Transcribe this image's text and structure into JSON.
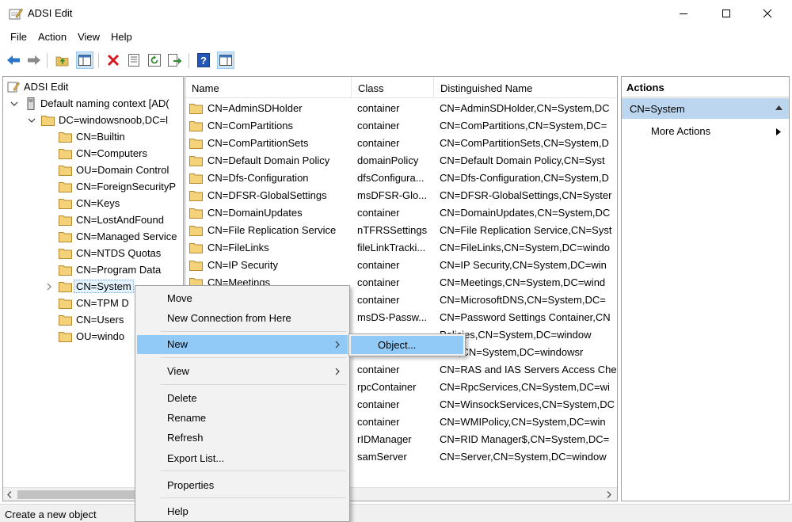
{
  "window": {
    "title": "ADSI Edit"
  },
  "menu": [
    "File",
    "Action",
    "View",
    "Help"
  ],
  "toolbar_icons": [
    "back-arrow-icon",
    "forward-arrow-icon",
    "up-folder-icon",
    "show-hide-tree-icon",
    "delete-icon",
    "properties-icon",
    "refresh-icon",
    "export-list-icon",
    "help-icon",
    "show-hide-action-pane-icon"
  ],
  "tree": {
    "root": "ADSI Edit",
    "context": "Default naming context [AD(",
    "domain": "DC=windowsnoob,DC=l",
    "children": [
      "CN=Builtin",
      "CN=Computers",
      "OU=Domain Control",
      "CN=ForeignSecurityP",
      "CN=Keys",
      "CN=LostAndFound",
      "CN=Managed Service",
      "CN=NTDS Quotas",
      "CN=Program Data",
      "CN=System",
      "CN=TPM D",
      "CN=Users",
      "OU=windo"
    ],
    "selected": "CN=System"
  },
  "list": {
    "columns": [
      "Name",
      "Class",
      "Distinguished Name"
    ],
    "rows": [
      {
        "name": "CN=AdminSDHolder",
        "class": "container",
        "dn": "CN=AdminSDHolder,CN=System,DC"
      },
      {
        "name": "CN=ComPartitions",
        "class": "container",
        "dn": "CN=ComPartitions,CN=System,DC="
      },
      {
        "name": "CN=ComPartitionSets",
        "class": "container",
        "dn": "CN=ComPartitionSets,CN=System,D"
      },
      {
        "name": "CN=Default Domain Policy",
        "class": "domainPolicy",
        "dn": "CN=Default Domain Policy,CN=Syst"
      },
      {
        "name": "CN=Dfs-Configuration",
        "class": "dfsConfigura...",
        "dn": "CN=Dfs-Configuration,CN=System,D"
      },
      {
        "name": "CN=DFSR-GlobalSettings",
        "class": "msDFSR-Glo...",
        "dn": "CN=DFSR-GlobalSettings,CN=Syster"
      },
      {
        "name": "CN=DomainUpdates",
        "class": "container",
        "dn": "CN=DomainUpdates,CN=System,DC"
      },
      {
        "name": "CN=File Replication Service",
        "class": "nTFRSSettings",
        "dn": "CN=File Replication Service,CN=Syst"
      },
      {
        "name": "CN=FileLinks",
        "class": "fileLinkTracki...",
        "dn": "CN=FileLinks,CN=System,DC=windo"
      },
      {
        "name": "CN=IP Security",
        "class": "container",
        "dn": "CN=IP Security,CN=System,DC=win"
      },
      {
        "name": "CN=Meetings",
        "class": "container",
        "dn": "CN=Meetings,CN=System,DC=wind"
      },
      {
        "name": "",
        "class": "container",
        "dn": "CN=MicrosoftDNS,CN=System,DC="
      },
      {
        "name": "",
        "class": "msDS-Passw...",
        "dn": "CN=Password Settings Container,CN"
      },
      {
        "name": "",
        "class": "",
        "dn": "Policies,CN=System,DC=window"
      },
      {
        "name": "",
        "class": "",
        "dn": "SPs,CN=System,DC=windowsr"
      },
      {
        "name": "",
        "class": "container",
        "dn": "CN=RAS and IAS Servers Access Che"
      },
      {
        "name": "",
        "class": "rpcContainer",
        "dn": "CN=RpcServices,CN=System,DC=wi"
      },
      {
        "name": "",
        "class": "container",
        "dn": "CN=WinsockServices,CN=System,DC"
      },
      {
        "name": "",
        "class": "container",
        "dn": "CN=WMIPolicy,CN=System,DC=win"
      },
      {
        "name": "",
        "class": "rIDManager",
        "dn": "CN=RID Manager$,CN=System,DC="
      },
      {
        "name": "",
        "class": "samServer",
        "dn": "CN=Server,CN=System,DC=window"
      }
    ]
  },
  "actions": {
    "title": "Actions",
    "section": "CN=System",
    "item": "More Actions"
  },
  "context_menu": {
    "items": [
      {
        "label": "Move"
      },
      {
        "label": "New Connection from Here"
      },
      {
        "label": "New"
      },
      {
        "label": "View"
      },
      {
        "label": "Delete"
      },
      {
        "label": "Rename"
      },
      {
        "label": "Refresh"
      },
      {
        "label": "Export List..."
      },
      {
        "label": "Properties"
      },
      {
        "label": "Help"
      }
    ],
    "submenu_item": "Object..."
  },
  "status": "Create a new object",
  "colors": {
    "highlight": "#91c9f7",
    "selection": "#bdd6f0",
    "folder": "#e8c15a"
  }
}
